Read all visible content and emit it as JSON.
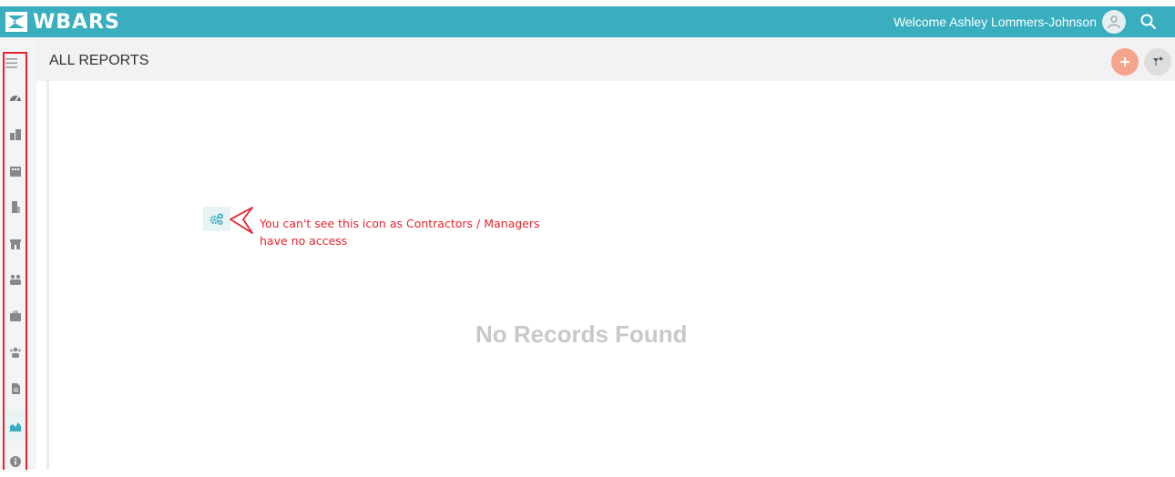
{
  "app": {
    "name": "WBARS"
  },
  "header": {
    "welcome_text": "Welcome Ashley Lommers-Johnson"
  },
  "sidebar": {
    "items": [
      {
        "icon": "dashboard-icon",
        "active": false
      },
      {
        "icon": "buildings-icon",
        "active": false
      },
      {
        "icon": "apartment-icon",
        "active": false
      },
      {
        "icon": "office-building-icon",
        "active": false
      },
      {
        "icon": "property-icon",
        "active": false
      },
      {
        "icon": "users-group-icon",
        "active": false
      },
      {
        "icon": "briefcase-icon",
        "active": false
      },
      {
        "icon": "team-icon",
        "active": false
      },
      {
        "icon": "document-icon",
        "active": false
      },
      {
        "icon": "area-chart-icon",
        "active": true
      },
      {
        "icon": "info-icon",
        "active": false
      }
    ]
  },
  "page": {
    "title": "ALL REPORTS"
  },
  "annotation": {
    "text_line1": "You can't see this icon as Contractors / Managers",
    "text_line2": "have no access"
  },
  "empty_state": {
    "message": "No Records Found"
  },
  "colors": {
    "header_bg": "#38aebf",
    "annotation_red": "#e8232e",
    "add_button": "#f5a38a",
    "active_item_bg": "#e7f3f5"
  }
}
